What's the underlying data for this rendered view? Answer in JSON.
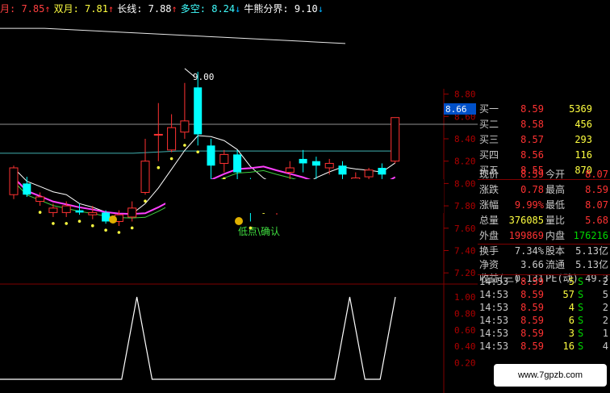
{
  "legend": [
    {
      "label": "月: ",
      "value": "7.85",
      "arrow": "↑",
      "color": "#ff4040"
    },
    {
      "label": "双月: ",
      "value": "7.81",
      "arrow": "↑",
      "color": "#ffff40"
    },
    {
      "label": "长线: ",
      "value": "7.88",
      "arrow": "↑",
      "color": "#ffffff"
    },
    {
      "label": "多空: ",
      "value": "8.24",
      "arrow": "↓",
      "color": "#40ffff"
    },
    {
      "label": "牛熊分界: ",
      "value": "9.10",
      "arrow": "↓",
      "color": "#ffffff"
    }
  ],
  "price_axis": [
    "8.80",
    "8.60",
    "8.40",
    "8.20",
    "8.00",
    "7.80",
    "7.60",
    "7.40",
    "7.20"
  ],
  "current_price_tag": "8.66",
  "osc_axis": [
    "1.00",
    "0.80",
    "0.60",
    "0.40",
    "0.20"
  ],
  "high_label": "9.00",
  "signal_text": "低点\\确认",
  "colors": {
    "up": "#ff3232",
    "down": "#00ffff",
    "bg": "#000000",
    "grid": "#800000",
    "up_text": "#ff3232",
    "down_text": "#00d800"
  },
  "chart_data": {
    "type": "candlestick",
    "ylim": [
      7.1,
      8.92
    ],
    "candles": [
      {
        "o": 7.9,
        "c": 8.14,
        "h": 8.16,
        "l": 7.86
      },
      {
        "o": 8.0,
        "c": 7.9,
        "h": 8.06,
        "l": 7.88
      },
      {
        "o": 7.84,
        "c": 7.88,
        "h": 7.92,
        "l": 7.8
      },
      {
        "o": 7.74,
        "c": 7.78,
        "h": 7.82,
        "l": 7.7
      },
      {
        "o": 7.74,
        "c": 7.8,
        "h": 7.84,
        "l": 7.7
      },
      {
        "o": 7.76,
        "c": 7.74,
        "h": 7.82,
        "l": 7.72
      },
      {
        "o": 7.72,
        "c": 7.74,
        "h": 7.8,
        "l": 7.68
      },
      {
        "o": 7.74,
        "c": 7.66,
        "h": 7.76,
        "l": 7.64
      },
      {
        "o": 7.66,
        "c": 7.72,
        "h": 7.76,
        "l": 7.62
      },
      {
        "o": 7.7,
        "c": 7.78,
        "h": 7.84,
        "l": 7.66
      },
      {
        "o": 7.92,
        "c": 8.2,
        "h": 8.4,
        "l": 7.9
      },
      {
        "o": 8.44,
        "c": 8.44,
        "h": 8.72,
        "l": 8.2
      },
      {
        "o": 8.3,
        "c": 8.5,
        "h": 8.62,
        "l": 8.28
      },
      {
        "o": 8.46,
        "c": 8.56,
        "h": 8.9,
        "l": 8.4
      },
      {
        "o": 8.86,
        "c": 8.44,
        "h": 9.0,
        "l": 8.34
      },
      {
        "o": 8.34,
        "c": 8.16,
        "h": 8.4,
        "l": 8.04
      },
      {
        "o": 8.18,
        "c": 8.26,
        "h": 8.3,
        "l": 8.1
      },
      {
        "o": 8.26,
        "c": 8.1,
        "h": 8.3,
        "l": 8.0
      },
      {
        "o": 8.0,
        "c": 7.8,
        "h": 8.05,
        "l": 7.66
      },
      {
        "o": 7.88,
        "c": 7.92,
        "h": 8.0,
        "l": 7.8
      },
      {
        "o": 7.84,
        "c": 7.86,
        "h": 8.0,
        "l": 7.72
      },
      {
        "o": 8.1,
        "c": 8.14,
        "h": 8.2,
        "l": 8.0
      },
      {
        "o": 8.22,
        "c": 8.18,
        "h": 8.3,
        "l": 8.1
      },
      {
        "o": 8.2,
        "c": 8.16,
        "h": 8.24,
        "l": 8.04
      },
      {
        "o": 8.14,
        "c": 8.18,
        "h": 8.22,
        "l": 8.08
      },
      {
        "o": 8.16,
        "c": 8.08,
        "h": 8.2,
        "l": 8.04
      },
      {
        "o": 8.0,
        "c": 8.05,
        "h": 8.1,
        "l": 7.96
      },
      {
        "o": 8.06,
        "c": 8.12,
        "h": 8.14,
        "l": 8.0
      },
      {
        "o": 8.14,
        "c": 8.08,
        "h": 8.18,
        "l": 8.04
      },
      {
        "o": 8.2,
        "c": 8.59,
        "h": 8.59,
        "l": 8.18
      }
    ],
    "lines": {
      "bull_bear": [
        9.1,
        9.1,
        9.08,
        9.06,
        9.04,
        9.02,
        9.0,
        8.98,
        8.96
      ],
      "long": [
        8.3,
        8.3,
        8.3,
        8.3,
        8.32,
        8.32,
        8.32,
        8.32,
        8.32,
        8.32
      ],
      "ma_cyan": [
        8.14,
        8.12,
        8.12,
        8.14,
        8.18,
        8.22,
        8.26,
        8.3,
        8.3,
        8.24,
        8.2,
        8.2,
        8.2,
        8.2,
        8.2,
        8.2
      ]
    },
    "oscillator": [
      0,
      0,
      0,
      0,
      0,
      0,
      0,
      0,
      0,
      1,
      0,
      0,
      0,
      0,
      0,
      0,
      0,
      0,
      0,
      0,
      0,
      0,
      0,
      1,
      0,
      0,
      1
    ]
  },
  "quote": {
    "bids": [
      {
        "label": "买一",
        "price": "8.59",
        "vol": "5369"
      },
      {
        "label": "买二",
        "price": "8.58",
        "vol": "456"
      },
      {
        "label": "买三",
        "price": "8.57",
        "vol": "293"
      },
      {
        "label": "买四",
        "price": "8.56",
        "vol": "116"
      },
      {
        "label": "买五",
        "price": "8.55",
        "vol": "870"
      }
    ],
    "stats": [
      {
        "l1": "现价",
        "v1": "8.59",
        "l2": "今开",
        "v2": "8.07"
      },
      {
        "l1": "涨跌",
        "v1": "0.78",
        "l2": "最高",
        "v2": "8.59"
      },
      {
        "l1": "涨幅",
        "v1": "9.99%",
        "l2": "最低",
        "v2": "8.07"
      },
      {
        "l1": "总量",
        "v1": "376085",
        "l2": "量比",
        "v2": "5.68"
      },
      {
        "l1": "外盘",
        "v1": "199869",
        "l2": "内盘",
        "v2": "176216"
      }
    ],
    "fundamentals": [
      {
        "l1": "换手",
        "v1": "7.34%",
        "l2": "股本",
        "v2": "5.13亿"
      },
      {
        "l1": "净资",
        "v1": "3.66",
        "l2": "流通",
        "v2": "5.13亿"
      },
      {
        "l1": "收益(三)",
        "v1": "0.131",
        "l2": "PE(动)",
        "v2": "49.3"
      }
    ],
    "ticks": [
      {
        "time": "14:53",
        "price": "8.59",
        "vol": "5",
        "side": "S",
        "count": "2"
      },
      {
        "time": "14:53",
        "price": "8.59",
        "vol": "57",
        "side": "S",
        "count": "5"
      },
      {
        "time": "14:53",
        "price": "8.59",
        "vol": "4",
        "side": "S",
        "count": "2"
      },
      {
        "time": "14:53",
        "price": "8.59",
        "vol": "6",
        "side": "S",
        "count": "2"
      },
      {
        "time": "14:53",
        "price": "8.59",
        "vol": "3",
        "side": "S",
        "count": "1"
      },
      {
        "time": "14:53",
        "price": "8.59",
        "vol": "16",
        "side": "S",
        "count": "4"
      }
    ]
  },
  "watermark": "www.7gpzb.com"
}
